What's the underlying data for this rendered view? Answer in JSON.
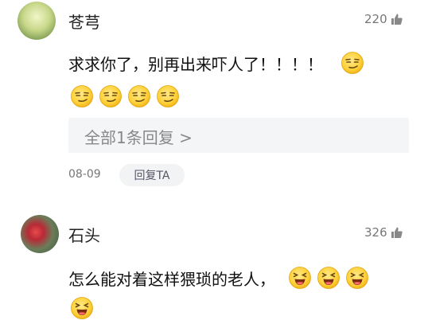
{
  "comments": [
    {
      "username": "苍芎",
      "likes": "220",
      "text": "求求你了，别再出来吓人了！！！！",
      "reply_summary": "全部1条回复 >",
      "date": "08-09",
      "reply_button": "回复TA",
      "emoji": "smirk-emoji"
    },
    {
      "username": "石头",
      "likes": "326",
      "text": "怎么能对着这样猥琐的老人，",
      "emoji": "grin-squint-emoji"
    }
  ]
}
